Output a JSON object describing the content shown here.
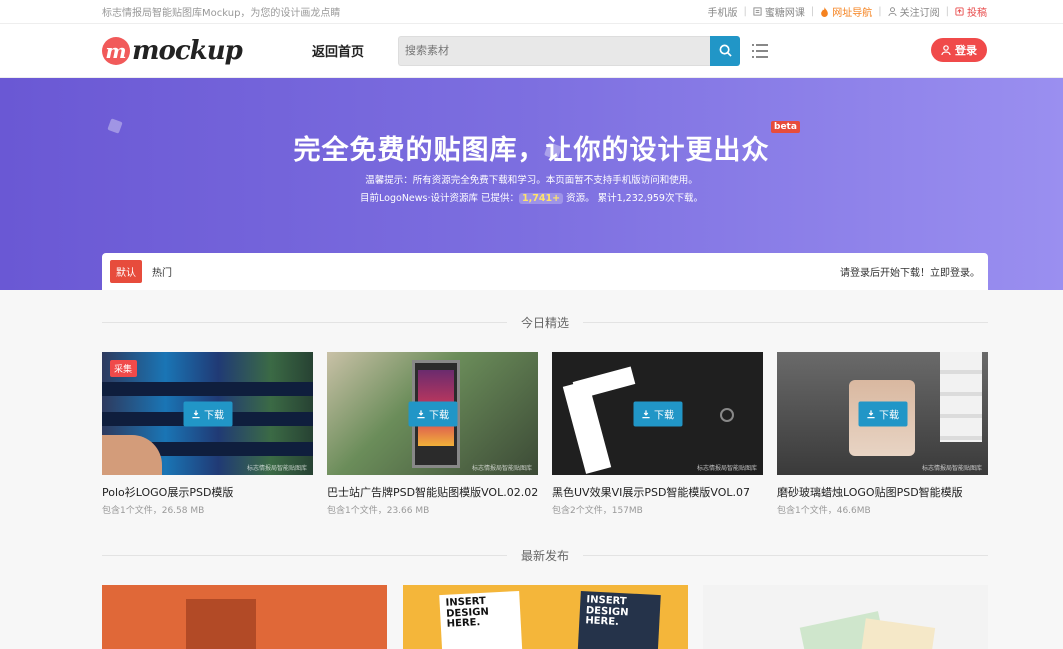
{
  "topbar": {
    "tagline": "标志情报局智能贴图库Mockup，为您的设计画龙点睛",
    "links": [
      {
        "label": "手机版",
        "icon": "",
        "color": "default"
      },
      {
        "label": "蜜糖网课",
        "icon": "book-icon",
        "color": "default"
      },
      {
        "label": "网址导航",
        "icon": "fire-icon",
        "color": "orange"
      },
      {
        "label": "关注订阅",
        "icon": "user-icon",
        "color": "default"
      },
      {
        "label": "投稿",
        "icon": "upload-icon",
        "color": "red"
      }
    ]
  },
  "header": {
    "logo_text": "mockup",
    "logo_letter": "m",
    "home_label": "返回首页",
    "search_placeholder": "搜索素材",
    "login_label": "登录"
  },
  "hero": {
    "title": "完全免费的贴图库，让你的设计更出众",
    "badge": "beta",
    "tip": "温馨提示：所有资源完全免费下载和学习。本页面暂不支持手机版访问和使用。",
    "stat_prefix": "目前LogoNews·设计资源库 已提供：",
    "stat_count": "1,741+",
    "stat_suffix": " 资源。 累计1,232,959次下载。"
  },
  "tabs": {
    "items": [
      "默认",
      "热门"
    ],
    "active": 0,
    "notice": "请登录后开始下载！立即登录。"
  },
  "featured": {
    "heading": "今日精选",
    "download_label": "下载",
    "watermark": "标志情报局智能贴图库",
    "ribbon": "采集",
    "items": [
      {
        "title": "Polo衫LOGO展示PSD模版",
        "meta": "包含1个文件，26.58 MB"
      },
      {
        "title": "巴士站广告牌PSD智能贴图模版VOL.02.02",
        "meta": "包含1个文件，23.66 MB"
      },
      {
        "title": "黑色UV效果VI展示PSD智能模版VOL.07",
        "meta": "包含2个文件，157MB"
      },
      {
        "title": "磨砂玻璃蜡烛LOGO贴图PSD智能模版",
        "meta": "包含1个文件，46.6MB"
      }
    ]
  },
  "latest": {
    "heading": "最新发布",
    "sheet_text": "INSERT DESIGN HERE."
  },
  "colors": {
    "accent_red": "#f04a4a",
    "accent_blue": "#2196c7",
    "hero_start": "#6a58d4",
    "hero_end": "#9a8ff0"
  }
}
